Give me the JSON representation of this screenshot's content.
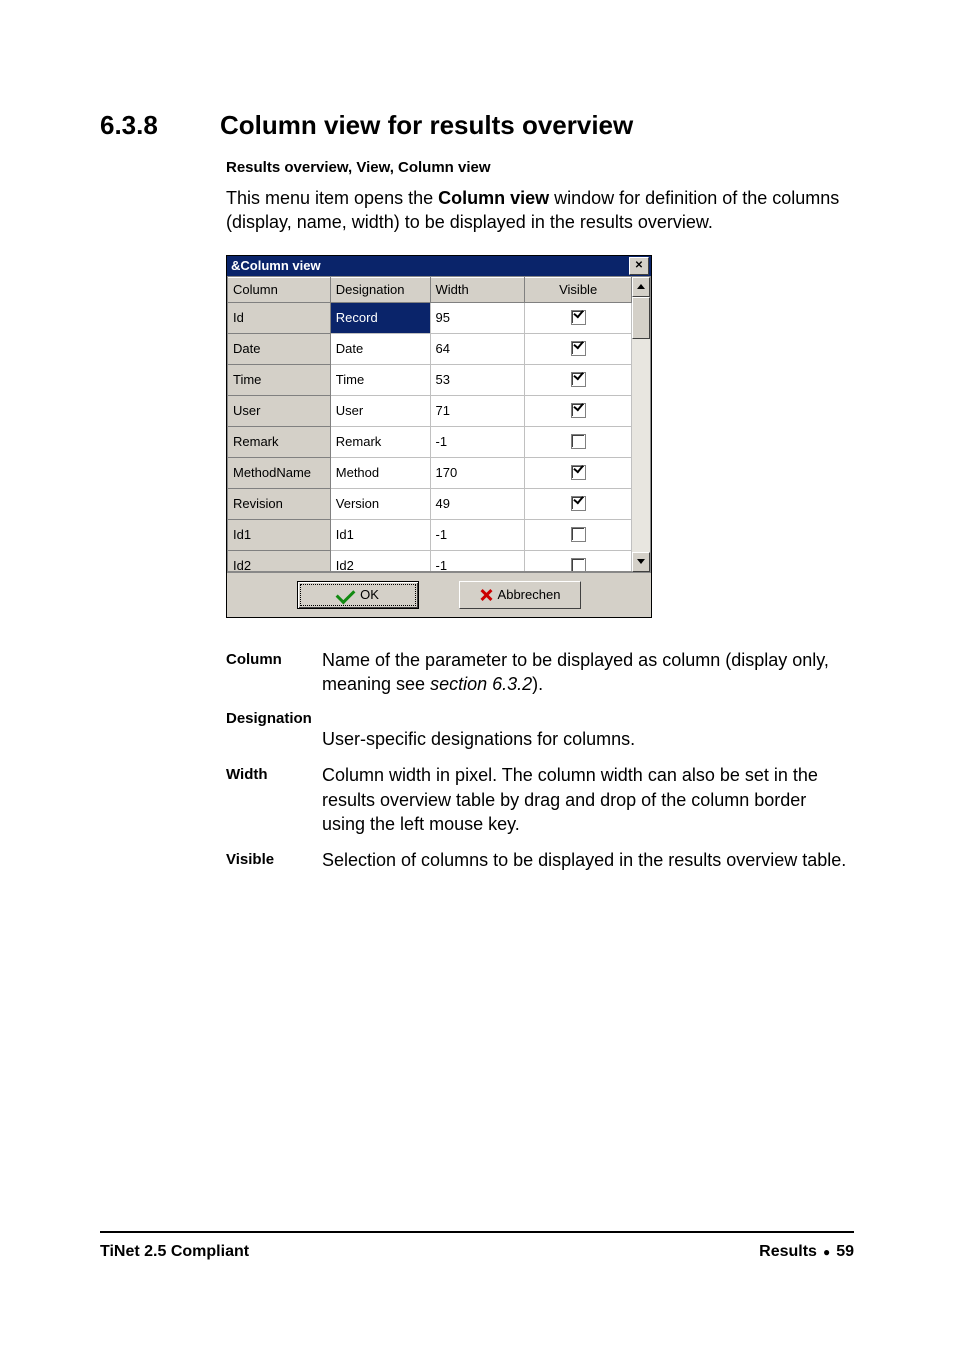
{
  "section": {
    "number": "6.3.8",
    "title": "Column view for results overview"
  },
  "breadcrumb": "Results overview, View, Column view",
  "intro": {
    "part1": "This menu item opens the ",
    "bold": "Column view",
    "part2": " window for definition of the columns (display, name, width) to be displayed in the results overview."
  },
  "dialog": {
    "title": "&Column view",
    "headers": {
      "column": "Column",
      "designation": "Designation",
      "width": "Width",
      "visible": "Visible"
    },
    "rows": [
      {
        "column": "Id",
        "designation": "Record",
        "designation_selected": true,
        "width": "95",
        "visible": true
      },
      {
        "column": "Date",
        "designation": "Date",
        "width": "64",
        "visible": true
      },
      {
        "column": "Time",
        "designation": "Time",
        "width": "53",
        "visible": true
      },
      {
        "column": "User",
        "designation": "User",
        "width": "71",
        "visible": true
      },
      {
        "column": "Remark",
        "designation": "Remark",
        "width": "-1",
        "visible": false
      },
      {
        "column": "MethodName",
        "designation": "Method",
        "width": "170",
        "visible": true
      },
      {
        "column": "Revision",
        "designation": "Version",
        "width": "49",
        "visible": true
      },
      {
        "column": "Id1",
        "designation": "Id1",
        "width": "-1",
        "visible": false
      },
      {
        "column": "Id2",
        "designation": "Id2",
        "width": "-1",
        "visible": false
      }
    ],
    "buttons": {
      "ok": "OK",
      "cancel": "Abbrechen"
    }
  },
  "definitions": {
    "column": {
      "term": "Column",
      "text_a": "Name of the parameter to be displayed as column (display only, meaning see ",
      "italic": "section 6.3.2",
      "text_b": ")."
    },
    "designation": {
      "term": "Designation",
      "text": "User-specific designations for columns."
    },
    "width": {
      "term": "Width",
      "text": "Column width in pixel. The column width can also be set in the results overview table by drag and drop of the column border using the left mouse key."
    },
    "visible": {
      "term": "Visible",
      "text": "Selection of columns to be displayed in the results overview table."
    }
  },
  "footer": {
    "left": "TiNet 2.5 Compliant",
    "right_label": "Results",
    "page": "59"
  }
}
